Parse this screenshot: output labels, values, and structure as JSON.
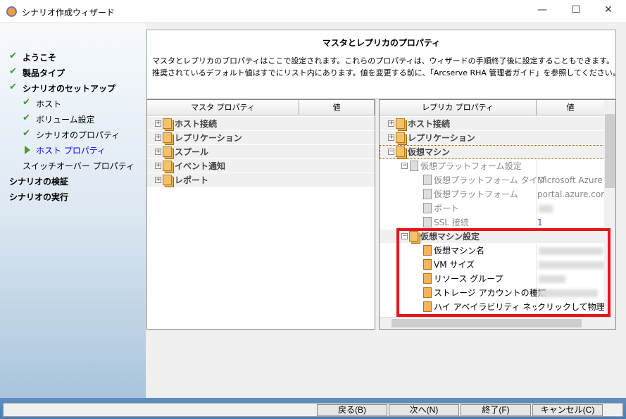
{
  "window": {
    "title": "シナリオ作成ウィザード",
    "minimize": "—",
    "maximize": "☐",
    "close": "✕"
  },
  "nav": [
    {
      "label": "ようこそ",
      "state": "done"
    },
    {
      "label": "製品タイプ",
      "state": "done"
    },
    {
      "label": "シナリオのセットアップ",
      "state": "done"
    },
    {
      "label": "ホスト",
      "state": "done"
    },
    {
      "label": "ボリューム設定",
      "state": "done"
    },
    {
      "label": "シナリオのプロパティ",
      "state": "done"
    },
    {
      "label": "ホスト プロパティ",
      "state": "current"
    },
    {
      "label": "スイッチオーバー プロパティ",
      "state": "pending"
    },
    {
      "label": "シナリオの検証",
      "state": "pending"
    },
    {
      "label": "シナリオの実行",
      "state": "pending"
    }
  ],
  "header": {
    "title": "マスタとレプリカのプロパティ",
    "line1": "マスタとレプリカのプロパティはここで設定されます。これらのプロパティは、ウィザードの手順終了後に設定することもできます。",
    "line2": "推奨されているデフォルト値はすでにリスト内にあります。値を変更する前に、「Arcserve RHA 管理者ガイド」を参照してください。"
  },
  "master": {
    "col_name": "マスタ プロパティ",
    "col_value": "値",
    "groups": [
      "ホスト接続",
      "レプリケーション",
      "スプール",
      "イベント通知",
      "レポート"
    ]
  },
  "replica": {
    "col_name": "レプリカ プロパティ",
    "col_value": "値",
    "groups": [
      "ホスト接続",
      "レプリケーション",
      "仮想マシン"
    ],
    "platform_group": "仮想プラットフォーム設定",
    "platform_items": [
      {
        "name": "仮想プラットフォーム タイプ",
        "value": "Microsoft Azure"
      },
      {
        "name": "仮想プラットフォーム",
        "value": "portal.azure.com"
      },
      {
        "name": "ポート",
        "value": ""
      },
      {
        "name": "SSL 接続",
        "value": "1"
      }
    ],
    "vm_group": "仮想マシン設定",
    "vm_items": [
      {
        "name": "仮想マシン名",
        "value": ""
      },
      {
        "name": "VM サイズ",
        "value": ""
      },
      {
        "name": "リソース グループ",
        "value": ""
      },
      {
        "name": "ストレージ アカウントの種類",
        "value": ""
      },
      {
        "name": "ハイ アベイラビリティ ネットワー...",
        "value": "クリックして物理ネット"
      }
    ]
  },
  "buttons": {
    "back": "戻る(B)",
    "next": "次へ(N)",
    "finish": "終了(F)",
    "cancel": "キャンセル(C)"
  },
  "colors": {
    "highlight": "#e8141c",
    "current_nav": "#0000ff"
  }
}
